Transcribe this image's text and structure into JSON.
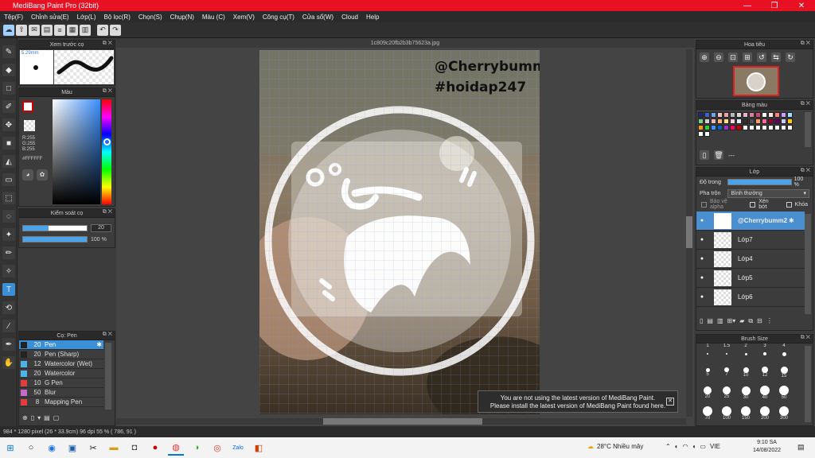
{
  "window": {
    "title": "MediBang Paint Pro (32bit)",
    "minimize": "—",
    "maximize": "❐",
    "close": "✕"
  },
  "menu": [
    "Tệp(F)",
    "Chỉnh sửa(E)",
    "Lớp(L)",
    "Bộ lọc(R)",
    "Chọn(S)",
    "Chụp(N)",
    "Màu (C)",
    "Xem(V)",
    "Công cụ(T)",
    "Cửa sổ(W)",
    "Cloud",
    "Help"
  ],
  "tab": {
    "file": "1c809c20fb2b3b75623a.jpg"
  },
  "preview": {
    "title": "Xem trước cọ",
    "size": "5.29mm"
  },
  "color": {
    "title": "Màu",
    "r": "R:255",
    "g": "G:255",
    "b": "B:255",
    "hex": "#FFFFFF"
  },
  "brush_control": {
    "title": "Kiểm soát cọ",
    "size": "20",
    "opacity": "100 %"
  },
  "brushes": {
    "title": "Cọ: Pen",
    "items": [
      {
        "size": "20",
        "name": "Pen",
        "color": "#222222"
      },
      {
        "size": "20",
        "name": "Pen (Sharp)",
        "color": "#222222"
      },
      {
        "size": "12",
        "name": "Watercolor (Wet)",
        "color": "#4fb3e8"
      },
      {
        "size": "20",
        "name": "Watercolor",
        "color": "#4fb3e8"
      },
      {
        "size": "10",
        "name": "G Pen",
        "color": "#e33c3c"
      },
      {
        "size": "50",
        "name": "Blur",
        "color": "#c46ac8"
      },
      {
        "size": "8",
        "name": "Mapping Pen",
        "color": "#e33c3c"
      }
    ]
  },
  "navigator": {
    "title": "Hoa tiêu"
  },
  "palette": {
    "title": "Bảng màu",
    "extra": "---",
    "colors": [
      "#1e2b6e",
      "#3d63c9",
      "#71a4e8",
      "#f1c1c1",
      "#f0a0a0",
      "#b8b8b8",
      "#d9d9d9",
      "#e8b5d0",
      "#e07c9a",
      "#c94a70",
      "#ffffff",
      "#ffe4e1",
      "#ff7f7f",
      "#c8a0ff",
      "#a0e0ff",
      "#80d080",
      "#d0d0d0",
      "#f8b4b4",
      "#ffb380",
      "#ffe082",
      "#ffd0e0",
      "#e0f0ff",
      "#303030",
      "#505050",
      "#ff9966",
      "#ff6699",
      "#990033",
      "#660066",
      "#ccccff",
      "#ffcc00",
      "#ff9900",
      "#33cc33",
      "#3399ff",
      "#0066cc",
      "#9933cc",
      "#ff0066",
      "#cc0000",
      "#ffffff",
      "#ffffff",
      "#ffffff",
      "#ffffff",
      "#ffffff",
      "#ffffff",
      "#ffffff",
      "#ffffff",
      "#ffffff",
      "#ffffff"
    ]
  },
  "layers": {
    "title": "Lớp",
    "opacity_label": "Độ trong",
    "opacity_value": "100 %",
    "blend_label": "Pha trộn",
    "blend_value": "Bình thường",
    "protect_alpha": "Bảo vệ alpha",
    "clipping": "Xén bớt",
    "lock": "Khóa",
    "items": [
      {
        "name": "@Cherrybumm2"
      },
      {
        "name": "Lớp7"
      },
      {
        "name": "Lớp4"
      },
      {
        "name": "Lớp5"
      },
      {
        "name": "Lớp6"
      }
    ]
  },
  "brush_size": {
    "title": "Brush Size",
    "sizes": [
      "1",
      "1.5",
      "2",
      "3",
      "4",
      "5",
      "7",
      "10",
      "12",
      "15",
      "20",
      "25",
      "30",
      "40",
      "50",
      "70",
      "100",
      "150",
      "200",
      "300"
    ]
  },
  "canvas_text": {
    "line1": "@Cherrybumm2",
    "line2": "#hoidap247"
  },
  "notification": {
    "line1": "You are not using the latest version of MediBang Paint.",
    "line2": "Please install the latest version of MediBang Paint found here.",
    "close": "✕"
  },
  "status": {
    "text": "984 * 1280 pixel   (26 * 33.9cm)   96 dpi   55 %   ( 786, 91 )"
  },
  "taskbar": {
    "weather": "28°C  Nhiều mây",
    "lang": "VIE",
    "time": "9:10 SA",
    "date": "14/08/2022"
  }
}
